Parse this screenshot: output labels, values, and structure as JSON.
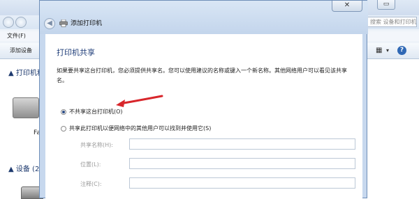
{
  "background_window": {
    "search_placeholder": "搜索 设备和打印机",
    "menu": [
      "文件(F)"
    ],
    "toolbar": {
      "add_device": "添加设备"
    },
    "sections": [
      {
        "label": "打印机和"
      },
      {
        "label": "设备 (2"
      }
    ],
    "device_label": "Fa"
  },
  "dialog": {
    "title": "添加打印机",
    "close_label": "✕",
    "heading": "打印机共享",
    "description": "如果要共享这台打印机，您必须提供共享名。您可以使用建议的名称或键入一个新名称。其他网络用户可以看见该共享名。",
    "options": [
      {
        "label": "不共享这台打印机(O)",
        "selected": true
      },
      {
        "label": "共享此打印机以便网络中的其他用户可以找到并使用它(S)",
        "selected": false
      }
    ],
    "fields": [
      {
        "label": "共享名称(H):",
        "value": ""
      },
      {
        "label": "位置(L):",
        "value": ""
      },
      {
        "label": "注释(C):",
        "value": ""
      }
    ]
  },
  "annotation": {
    "color": "#d8262b"
  }
}
